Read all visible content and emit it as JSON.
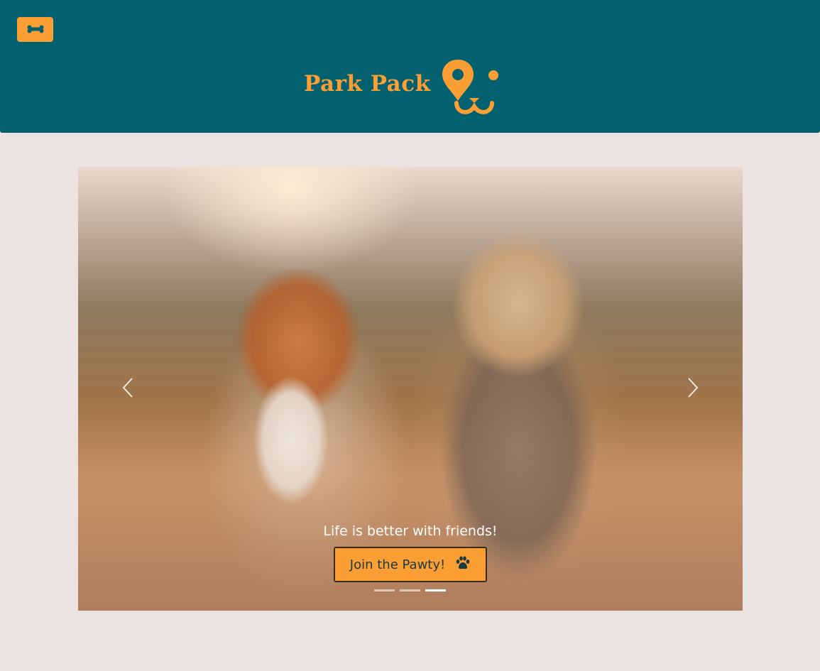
{
  "header": {
    "menu_icon": "bone-icon",
    "title": "Park Pack",
    "logo_icon": "dog-face-location-pin-icon"
  },
  "hero": {
    "image": "two-dogs-running-on-trail-photo",
    "prev_icon": "chevron-left-icon",
    "next_icon": "chevron-right-icon",
    "caption": "Life is better with friends!",
    "cta_label": "Join the Pawty!",
    "cta_icon": "paw-icon",
    "slide_count": 3,
    "active_slide": 3
  },
  "colors": {
    "header_bg": "#03606f",
    "accent": "#fb9e34",
    "page_bg": "#ebe3e1"
  }
}
